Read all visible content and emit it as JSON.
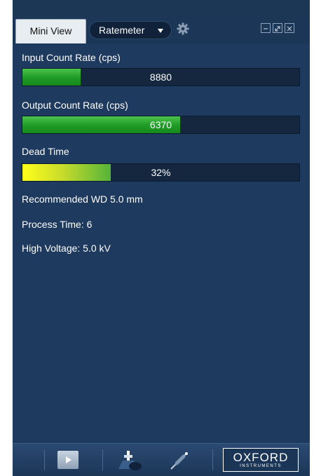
{
  "tabs": {
    "active": "Mini View",
    "mode_dropdown": "Ratemeter"
  },
  "meters": [
    {
      "label": "Input Count Rate (cps)",
      "value": "8880",
      "fill_fraction": 0.21,
      "color": "green"
    },
    {
      "label": "Output Count Rate (cps)",
      "value": "6370",
      "fill_fraction": 0.57,
      "color": "green"
    },
    {
      "label": "Dead Time",
      "value": "32%",
      "fill_fraction": 0.32,
      "color": "yellow"
    }
  ],
  "info": {
    "working_distance": "Recommended WD 5.0 mm",
    "process_time": "Process Time: 6",
    "high_voltage": "High Voltage: 5.0 kV"
  },
  "bottom_bar": {
    "logo_text": "OXFORD",
    "logo_subtext": "INSTRUMENTS"
  },
  "colors": {
    "panel_bg": "#1e3a5f",
    "meter_green": "#1f9a26",
    "meter_yellow": "#ffff1a",
    "meter_track": "#14273f"
  },
  "icons": [
    "gear-icon",
    "minimize-icon",
    "restore-icon",
    "close-icon",
    "play-icon",
    "detector-icon",
    "probe-icon"
  ]
}
